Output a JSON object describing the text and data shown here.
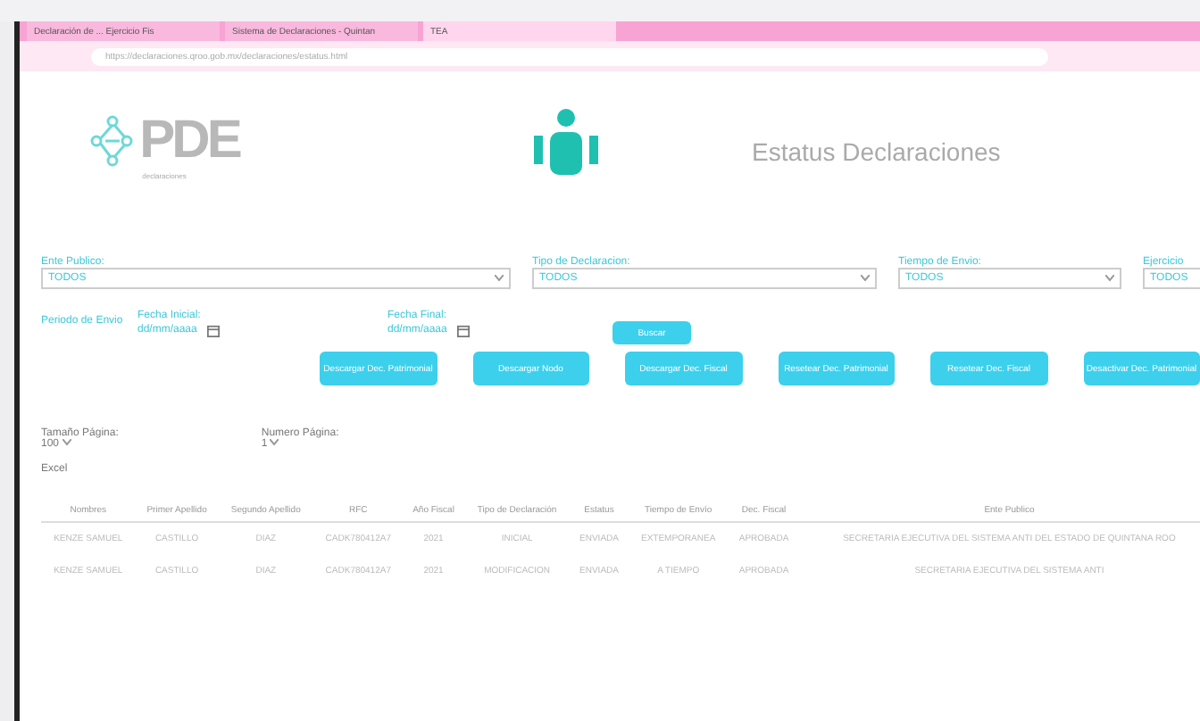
{
  "browser": {
    "tabs": [
      {
        "label": "Declaración de ... Ejercicio Fis",
        "selected": false
      },
      {
        "label": "Sistema de Declaraciones - Quintan",
        "selected": false
      },
      {
        "label": "TEA",
        "selected": true
      }
    ],
    "url": "https://declaraciones.qroo.gob.mx/declaraciones/estatus.html"
  },
  "header": {
    "logo_text": "PDE",
    "logo_subtitle": "declaraciones",
    "title": "Estatus Declaraciones"
  },
  "filters": [
    {
      "label": "Ente Publico:",
      "value": "TODOS"
    },
    {
      "label": "Tipo de Declaracion:",
      "value": "TODOS"
    },
    {
      "label": "Tiempo de Envio:",
      "value": "TODOS"
    },
    {
      "label": "Ejercicio",
      "value": "TODOS"
    }
  ],
  "period": {
    "label": "Periodo de Envio",
    "start_label": "Fecha Inicial:",
    "start_value": "dd/mm/aaaa",
    "end_label": "Fecha Final:",
    "end_value": "dd/mm/aaaa",
    "search_button": "Buscar"
  },
  "actions": [
    "Descargar Dec. Patrimonial",
    "Descargar Nodo",
    "Descargar Dec. Fiscal",
    "Resetear Dec. Patrimonial",
    "Resetear Dec. Fiscal",
    "Desactivar Dec. Patrimonial"
  ],
  "paging": {
    "size_label": "Tamaño Página:",
    "size_value": "100",
    "page_label": "Numero Página:",
    "page_value": "1",
    "export_link": "Excel"
  },
  "table": {
    "columns": [
      "Nombres",
      "Primer Apellido",
      "Segundo Apellido",
      "RFC",
      "Año Fiscal",
      "Tipo de Declaración",
      "Estatus",
      "Tiempo de Envío",
      "Dec. Fiscal",
      "Ente Publico"
    ],
    "rows": [
      [
        "KENZE SAMUEL",
        "CASTILLO",
        "DIAZ",
        "CADK780412A7",
        "2021",
        "INICIAL",
        "ENVIADA",
        "EXTEMPORANEA",
        "APROBADA",
        "SECRETARIA EJECUTIVA DEL SISTEMA ANTI DEL ESTADO DE QUINTANA ROO"
      ],
      [
        "KENZE SAMUEL",
        "CASTILLO",
        "DIAZ",
        "CADK780412A7",
        "2021",
        "MODIFICACION",
        "ENVIADA",
        "A TIEMPO",
        "APROBADA",
        "SECRETARIA EJECUTIVA DEL SISTEMA ANTI"
      ]
    ]
  }
}
